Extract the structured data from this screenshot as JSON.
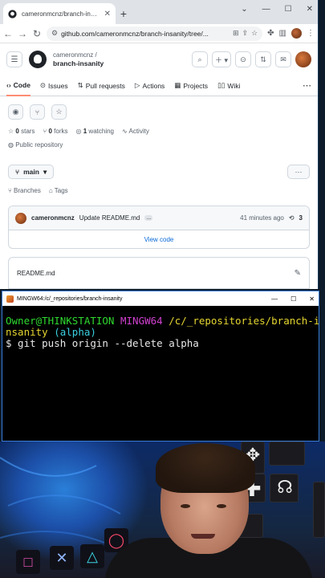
{
  "browser": {
    "tab_title": "cameronmcnz/branch-insanity",
    "new_tab_symbol": "+",
    "window_controls": [
      "⌄",
      "—",
      "☐",
      "✕"
    ],
    "url": "github.com/cameronmcnz/branch-insanity/tree/..."
  },
  "github": {
    "owner": "cameronmcnz /",
    "repo": "branch-insanity",
    "nav": [
      {
        "label": "Code",
        "icon": "code-icon",
        "glyph": "‹›"
      },
      {
        "label": "Issues",
        "icon": "issue-icon",
        "glyph": "⊙"
      },
      {
        "label": "Pull requests",
        "icon": "pull-request-icon",
        "glyph": "⇅"
      },
      {
        "label": "Actions",
        "icon": "play-icon",
        "glyph": "▷"
      },
      {
        "label": "Projects",
        "icon": "table-icon",
        "glyph": "▦"
      },
      {
        "label": "Wiki",
        "icon": "book-icon",
        "glyph": "▯▯"
      }
    ],
    "stars": "0",
    "stars_label": "stars",
    "forks": "0",
    "forks_label": "forks",
    "watching": "1",
    "watching_label": "watching",
    "activity_label": "Activity",
    "visibility": "Public repository",
    "branch": "main",
    "branches_label": "Branches",
    "tags_label": "Tags",
    "commit_author": "cameronmcnz",
    "commit_message": "Update README.md",
    "commit_ellipsis": "...",
    "commit_time": "41 minutes ago",
    "commit_count": "3",
    "view_code": "View code",
    "readme": "README.md"
  },
  "terminal": {
    "title": "MINGW64:/c/_repositories/branch-insanity",
    "line1_user": "Owner@THINKSTATION",
    "line1_host": "MINGW64",
    "line1_path": "/c/_repositories/branch-i",
    "line2_path": "nsanity",
    "line2_branch": "(alpha)",
    "line3_command": "$ git push origin --delete alpha"
  },
  "colors": {
    "accent_orange": "#fd8c73",
    "link_blue": "#0969da",
    "term_green": "#2fd92f",
    "term_magenta": "#d040d0",
    "term_yellow": "#e5d630",
    "term_cyan": "#3ad0e0"
  }
}
